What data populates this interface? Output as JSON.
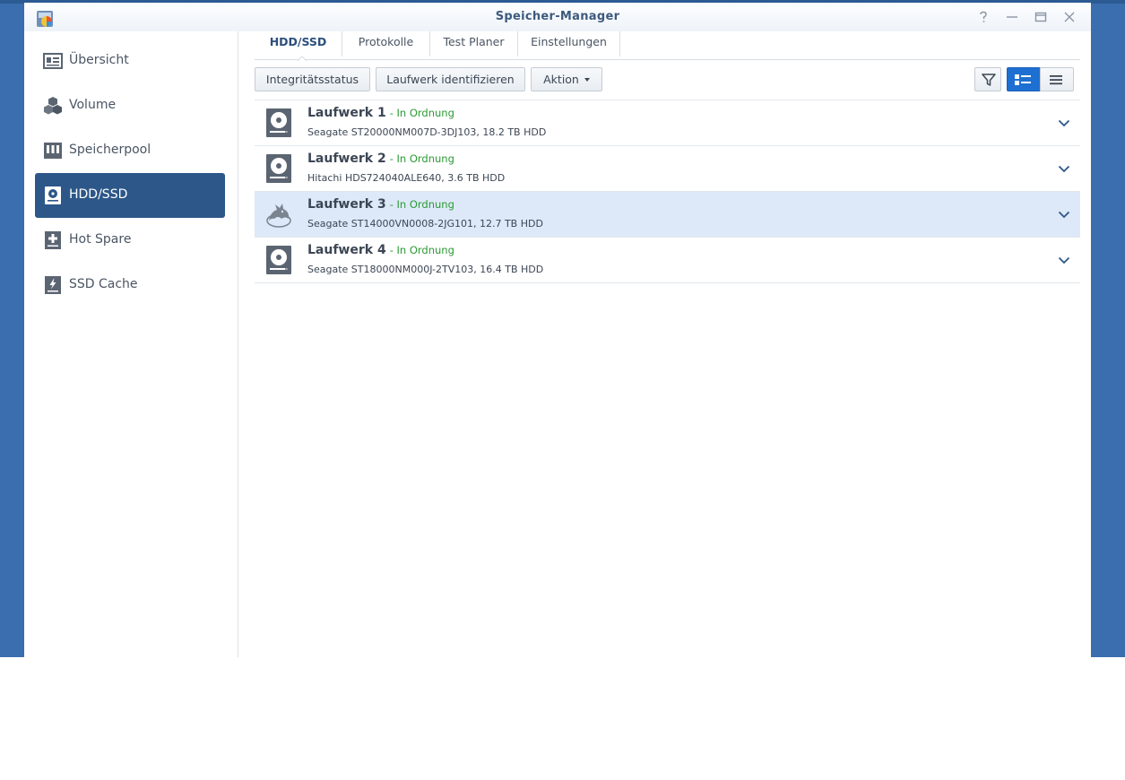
{
  "window": {
    "title": "Speicher-Manager"
  },
  "sidebar": {
    "items": [
      {
        "label": "Übersicht",
        "icon": "overview-icon",
        "active": false
      },
      {
        "label": "Volume",
        "icon": "volume-cubes-icon",
        "active": false
      },
      {
        "label": "Speicherpool",
        "icon": "storage-pool-icon",
        "active": false
      },
      {
        "label": "HDD/SSD",
        "icon": "hdd-icon",
        "active": true
      },
      {
        "label": "Hot Spare",
        "icon": "hot-spare-icon",
        "active": false
      },
      {
        "label": "SSD Cache",
        "icon": "ssd-cache-icon",
        "active": false
      }
    ]
  },
  "tabs": [
    {
      "label": "HDD/SSD",
      "active": true
    },
    {
      "label": "Protokolle",
      "active": false
    },
    {
      "label": "Test Planer",
      "active": false
    },
    {
      "label": "Einstellungen",
      "active": false
    }
  ],
  "toolbar": {
    "health_label": "Integritätsstatus",
    "identify_label": "Laufwerk identifizieren",
    "action_label": "Aktion"
  },
  "disks": [
    {
      "name": "Laufwerk 1",
      "status": "- In Ordnung",
      "model": "Seagate ST20000NM007D-3DJ103, 18.2 TB HDD",
      "icon": "hdd-disk-icon"
    },
    {
      "name": "Laufwerk 2",
      "status": "- In Ordnung",
      "model": "Hitachi HDS724040ALE640, 3.6 TB HDD",
      "icon": "hdd-disk-icon"
    },
    {
      "name": "Laufwerk 3",
      "status": "- In Ordnung",
      "model": "Seagate ST14000VN0008-2JG101, 12.7 TB HDD",
      "icon": "seagate-ironwolf-icon"
    },
    {
      "name": "Laufwerk 4",
      "status": "- In Ordnung",
      "model": "Seagate ST18000NM000J-2TV103, 16.4 TB HDD",
      "icon": "hdd-disk-icon"
    }
  ],
  "colors": {
    "accent": "#2c5788",
    "status_ok": "#2a9b34",
    "selected_row": "#dde9f8",
    "view_toggle_on": "#1e6fd2"
  }
}
